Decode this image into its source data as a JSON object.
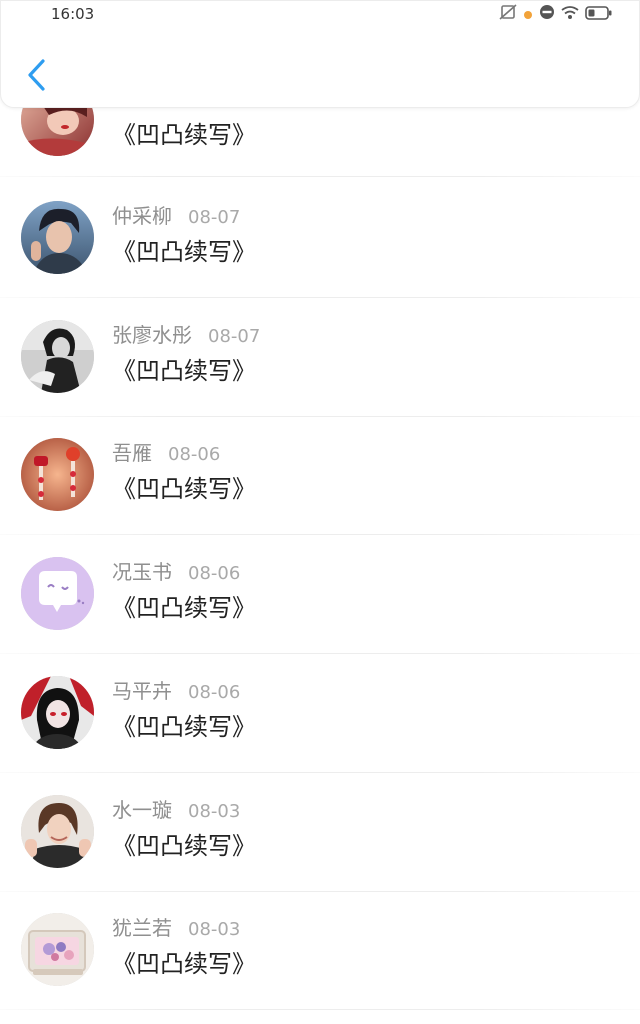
{
  "status_bar": {
    "time": "16:03",
    "icons": [
      "no-sim-icon",
      "notification-dot-icon",
      "do-not-disturb-icon",
      "wifi-icon",
      "battery-icon"
    ]
  },
  "header": {
    "back_icon": "chevron-left-icon",
    "accent_color": "#2e9df0"
  },
  "messages": [
    {
      "name": "",
      "date": "",
      "text": "《凹凸续写》",
      "avatar": "woman-red-photo"
    },
    {
      "name": "仲采柳",
      "date": "08-07",
      "text": "《凹凸续写》",
      "avatar": "young-man-photo"
    },
    {
      "name": "张廖水彤",
      "date": "08-07",
      "text": "《凹凸续写》",
      "avatar": "woman-monochrome-photo"
    },
    {
      "name": "吾雁",
      "date": "08-06",
      "text": "《凹凸续写》",
      "avatar": "red-lanterns-photo"
    },
    {
      "name": "况玉书",
      "date": "08-06",
      "text": "《凹凸续写》",
      "avatar": "purple-chat-bubble"
    },
    {
      "name": "马平卉",
      "date": "08-06",
      "text": "《凹凸续写》",
      "avatar": "anime-hooded-character"
    },
    {
      "name": "水一璇",
      "date": "08-03",
      "text": "《凹凸续写》",
      "avatar": "smiling-woman-photo"
    },
    {
      "name": "犹兰若",
      "date": "08-03",
      "text": "《凹凸续写》",
      "avatar": "flower-box-photo"
    }
  ]
}
